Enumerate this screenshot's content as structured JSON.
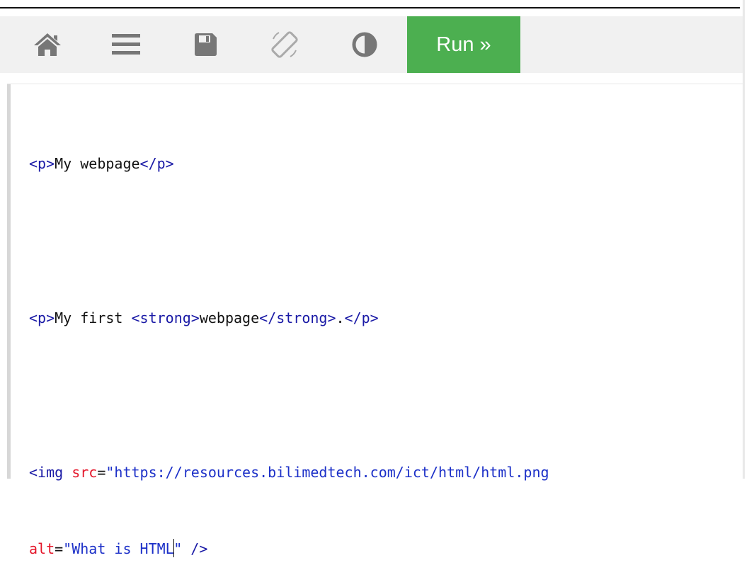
{
  "toolbar": {
    "icons": [
      "home-icon",
      "menu-icon",
      "save-icon",
      "rotate-icon",
      "contrast-icon"
    ],
    "run_label": "Run »"
  },
  "colors": {
    "run_bg": "#4caf50",
    "tag": "#1a1aa6",
    "attr": "#e4162a",
    "value": "#1c30c8"
  },
  "editor": {
    "line1": {
      "open": "<p>",
      "text": "My webpage",
      "close": "</p>"
    },
    "line2": {
      "open": "<p>",
      "text1": "My first ",
      "strong_open": "<strong>",
      "strong_text": "webpage",
      "strong_close": "</strong>",
      "text2": ".",
      "close": "</p>"
    },
    "line3": {
      "tag": "<img ",
      "attr_src": "src",
      "eq": "=",
      "src_value": "\"https://resources.bilimedtech.com/ict/html/html.png"
    },
    "line4": {
      "attr_alt": "alt",
      "eq": "=",
      "alt_value_a": "\"What is HTML",
      "alt_value_b": "\"",
      "closing": " />"
    }
  }
}
